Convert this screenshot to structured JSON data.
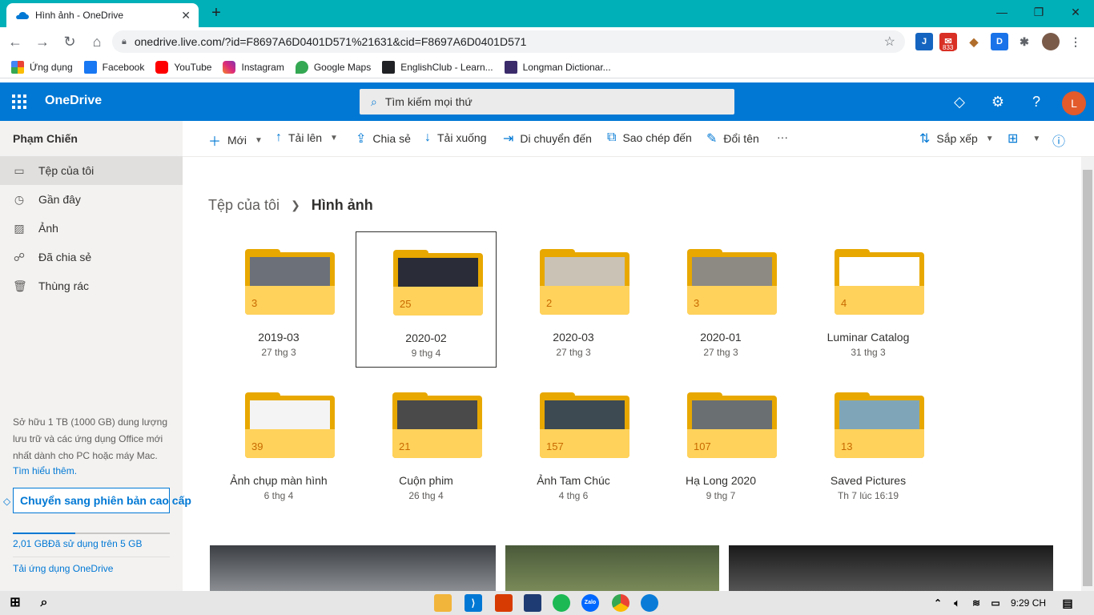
{
  "browser": {
    "tab_title": "Hình ảnh - OneDrive",
    "url": "onedrive.live.com/?id=F8697A6D0401D571%21631&cid=F8697A6D0401D571",
    "gmail_badge": "833",
    "bookmarks": [
      "Ứng dụng",
      "Facebook",
      "YouTube",
      "Instagram",
      "Google Maps",
      "EnglishClub - Learn...",
      "Longman Dictionar..."
    ]
  },
  "header": {
    "app_name": "OneDrive",
    "search_placeholder": "Tìm kiếm mọi thứ",
    "avatar_initial": "L"
  },
  "sidebar": {
    "user": "Phạm Chiến",
    "items": [
      {
        "label": "Tệp của tôi",
        "icon": "folder-icon",
        "active": true
      },
      {
        "label": "Gần đây",
        "icon": "clock-icon"
      },
      {
        "label": "Ảnh",
        "icon": "image-icon"
      },
      {
        "label": "Đã chia sẻ",
        "icon": "people-icon"
      },
      {
        "label": "Thùng rác",
        "icon": "trash-icon"
      }
    ],
    "storage_text": "Sở hữu 1 TB (1000 GB) dung lượng lưu trữ và các ứng dụng Office mới nhất dành cho PC hoặc máy Mac.",
    "learn_more": "Tìm hiểu thêm.",
    "upgrade": "Chuyển sang phiên bản cao cấp",
    "quota": "2,01 GBĐã sử dụng trên 5 GB",
    "quota_used_fraction": 0.4,
    "get_app": "Tải ứng dụng OneDrive"
  },
  "commands": {
    "new": "Mới",
    "upload": "Tải lên",
    "share": "Chia sẻ",
    "download": "Tải xuống",
    "move": "Di chuyển đến",
    "copy": "Sao chép đến",
    "rename": "Đổi tên",
    "more": "···",
    "sort": "Sắp xếp"
  },
  "breadcrumb": {
    "root": "Tệp của tôi",
    "current": "Hình ảnh"
  },
  "folders": [
    {
      "name": "2019-03",
      "date": "27 thg 3",
      "count": "3",
      "selected": false,
      "thumb_color": "#6b7079"
    },
    {
      "name": "2020-02",
      "date": "9 thg 4",
      "count": "25",
      "selected": true,
      "thumb_color": "#2a2d38"
    },
    {
      "name": "2020-03",
      "date": "27 thg 3",
      "count": "2",
      "selected": false,
      "thumb_color": "#c9c2b5"
    },
    {
      "name": "2020-01",
      "date": "27 thg 3",
      "count": "3",
      "selected": false,
      "thumb_color": "#8d8a83"
    },
    {
      "name": "Luminar Catalog",
      "date": "31 thg 3",
      "count": "4",
      "selected": false,
      "thumb_color": null
    },
    {
      "name": "Ảnh chụp màn hình",
      "date": "6 thg 4",
      "count": "39",
      "selected": false,
      "thumb_color": "#f4f4f4"
    },
    {
      "name": "Cuộn phim",
      "date": "26 thg 4",
      "count": "21",
      "selected": false,
      "thumb_color": "#4a4a4a"
    },
    {
      "name": "Ảnh Tam Chúc",
      "date": "4 thg 6",
      "count": "157",
      "selected": false,
      "thumb_color": "#3e4a52"
    },
    {
      "name": "Hạ Long 2020",
      "date": "9 thg 7",
      "count": "107",
      "selected": false,
      "thumb_color": "#6a6f72"
    },
    {
      "name": "Saved Pictures",
      "date": "Th 7 lúc 16:19",
      "count": "13",
      "selected": false,
      "thumb_color": "#7fa6b8"
    }
  ],
  "taskbar": {
    "clock": "9:29 CH"
  }
}
